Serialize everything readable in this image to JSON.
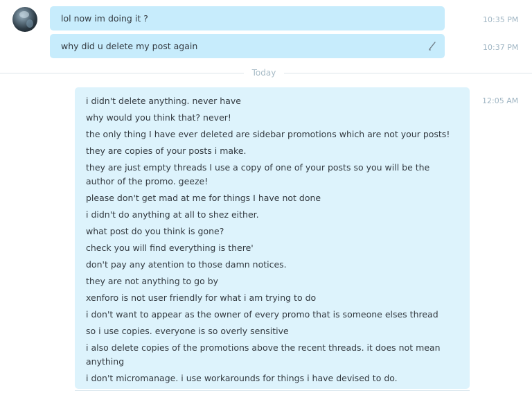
{
  "conversation": {
    "earlier_messages": [
      {
        "text": "lol now im doing it ?",
        "time": "10:35 PM"
      },
      {
        "text": "why did u delete my post again",
        "time": "10:37 PM",
        "edited": true
      }
    ],
    "day_divider": "Today",
    "reply": {
      "time": "12:05 AM",
      "lines": [
        "i didn't delete anything.  never have",
        "why would you think that?  never!",
        "the only thing I have ever deleted are sidebar promotions which are not your posts!",
        "they are copies of your posts i make.",
        "they are just empty threads I use a copy of one of your posts so you will be the author of the promo.  geeze!",
        "please don't get mad at me for things I have not done",
        "i didn't do anything at all to shez either.",
        "what post do you think is gone?",
        "check you will find everything is there'",
        "don't pay any atention to those damn notices.",
        "they are not anything to go by",
        "xenforo is not user friendly for what i am trying to do",
        "i don't want to appear as the owner of every promo that is someone elses thread",
        "so i use copies.  everyone is so overly sensitive",
        "i also delete copies of the promotions above the recent threads.  it does not mean anything",
        "i don't micromanage.  i use workarounds for things i have devised to do."
      ]
    }
  },
  "icons": {
    "avatar": "user-avatar",
    "edited": "pencil-icon"
  },
  "colors": {
    "bubble_incoming": "#c7ecfc",
    "bubble_outgoing": "#ddf3fc",
    "timestamp": "#9fb5c3",
    "text": "#333a40"
  }
}
